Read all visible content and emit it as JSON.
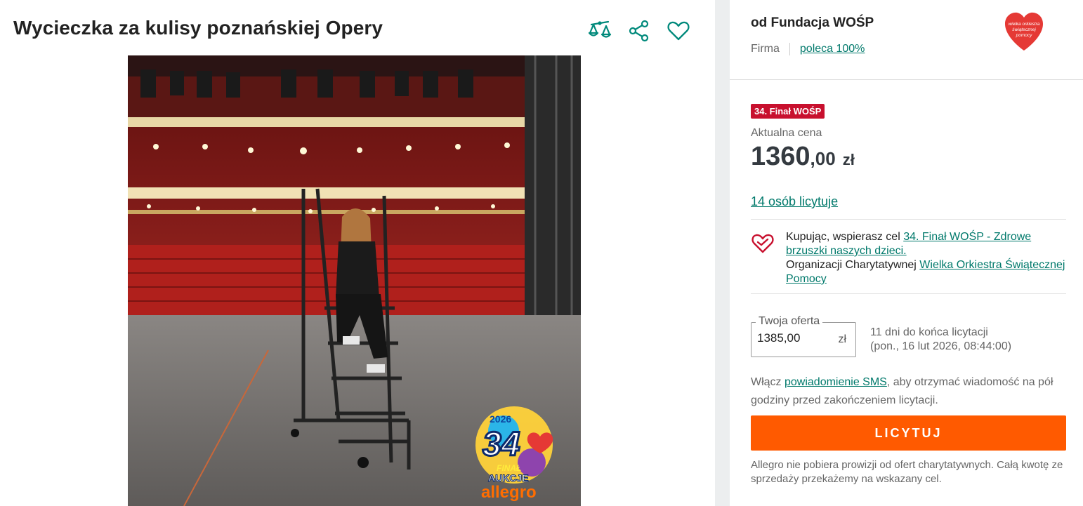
{
  "listing": {
    "title": "Wycieczka za kulisy poznańskiej Opery",
    "actions": [
      {
        "name": "compare-icon"
      },
      {
        "name": "share-icon"
      },
      {
        "name": "heart-icon"
      }
    ],
    "photo_badge": {
      "year": "2026",
      "number": "34",
      "line1": "FINAŁ",
      "line2": "AUKCJE",
      "brand": "allegro"
    }
  },
  "seller": {
    "name": "od Fundacja WOŚP",
    "type": "Firma",
    "recommend": "poleca 100%",
    "logo_text": "wielka orkiestra świątecznej pomocy"
  },
  "offer": {
    "badge": "34. Finał WOŚP",
    "price_label": "Aktualna cena",
    "price_int": "1360",
    "price_dec": ",00",
    "currency": "zł",
    "bidders": "14 osób licytuje"
  },
  "charity": {
    "text1": "Kupując, wspierasz cel ",
    "goal_link": "34. Finał WOŚP - Zdrowe brzuszki naszych dzieci.",
    "text2": "Organizacji Charytatywnej ",
    "org_link": "Wielka Orkiestra Świątecznej Pomocy"
  },
  "bid": {
    "legend": "Twoja oferta",
    "value": "1385,00",
    "currency": "zł",
    "deadline_line1": "11 dni do końca licytacji",
    "deadline_line2": "(pon., 16 lut 2026, 08:44:00)"
  },
  "sms": {
    "pre": "Włącz ",
    "link": "powiadomienie SMS",
    "post": ", aby otrzymać wiadomość na pół godziny przed zakończeniem licytacji."
  },
  "button": {
    "label": "LICYTUJ"
  },
  "note": "Allegro nie pobiera prowizji od ofert charytatywnych. Całą kwotę ze sprzedaży przekażemy na wskazany cel.",
  "colors": {
    "accent": "#00796b",
    "cta": "#ff5a00",
    "badge": "#c8102e",
    "gutter": "#eceeef"
  }
}
